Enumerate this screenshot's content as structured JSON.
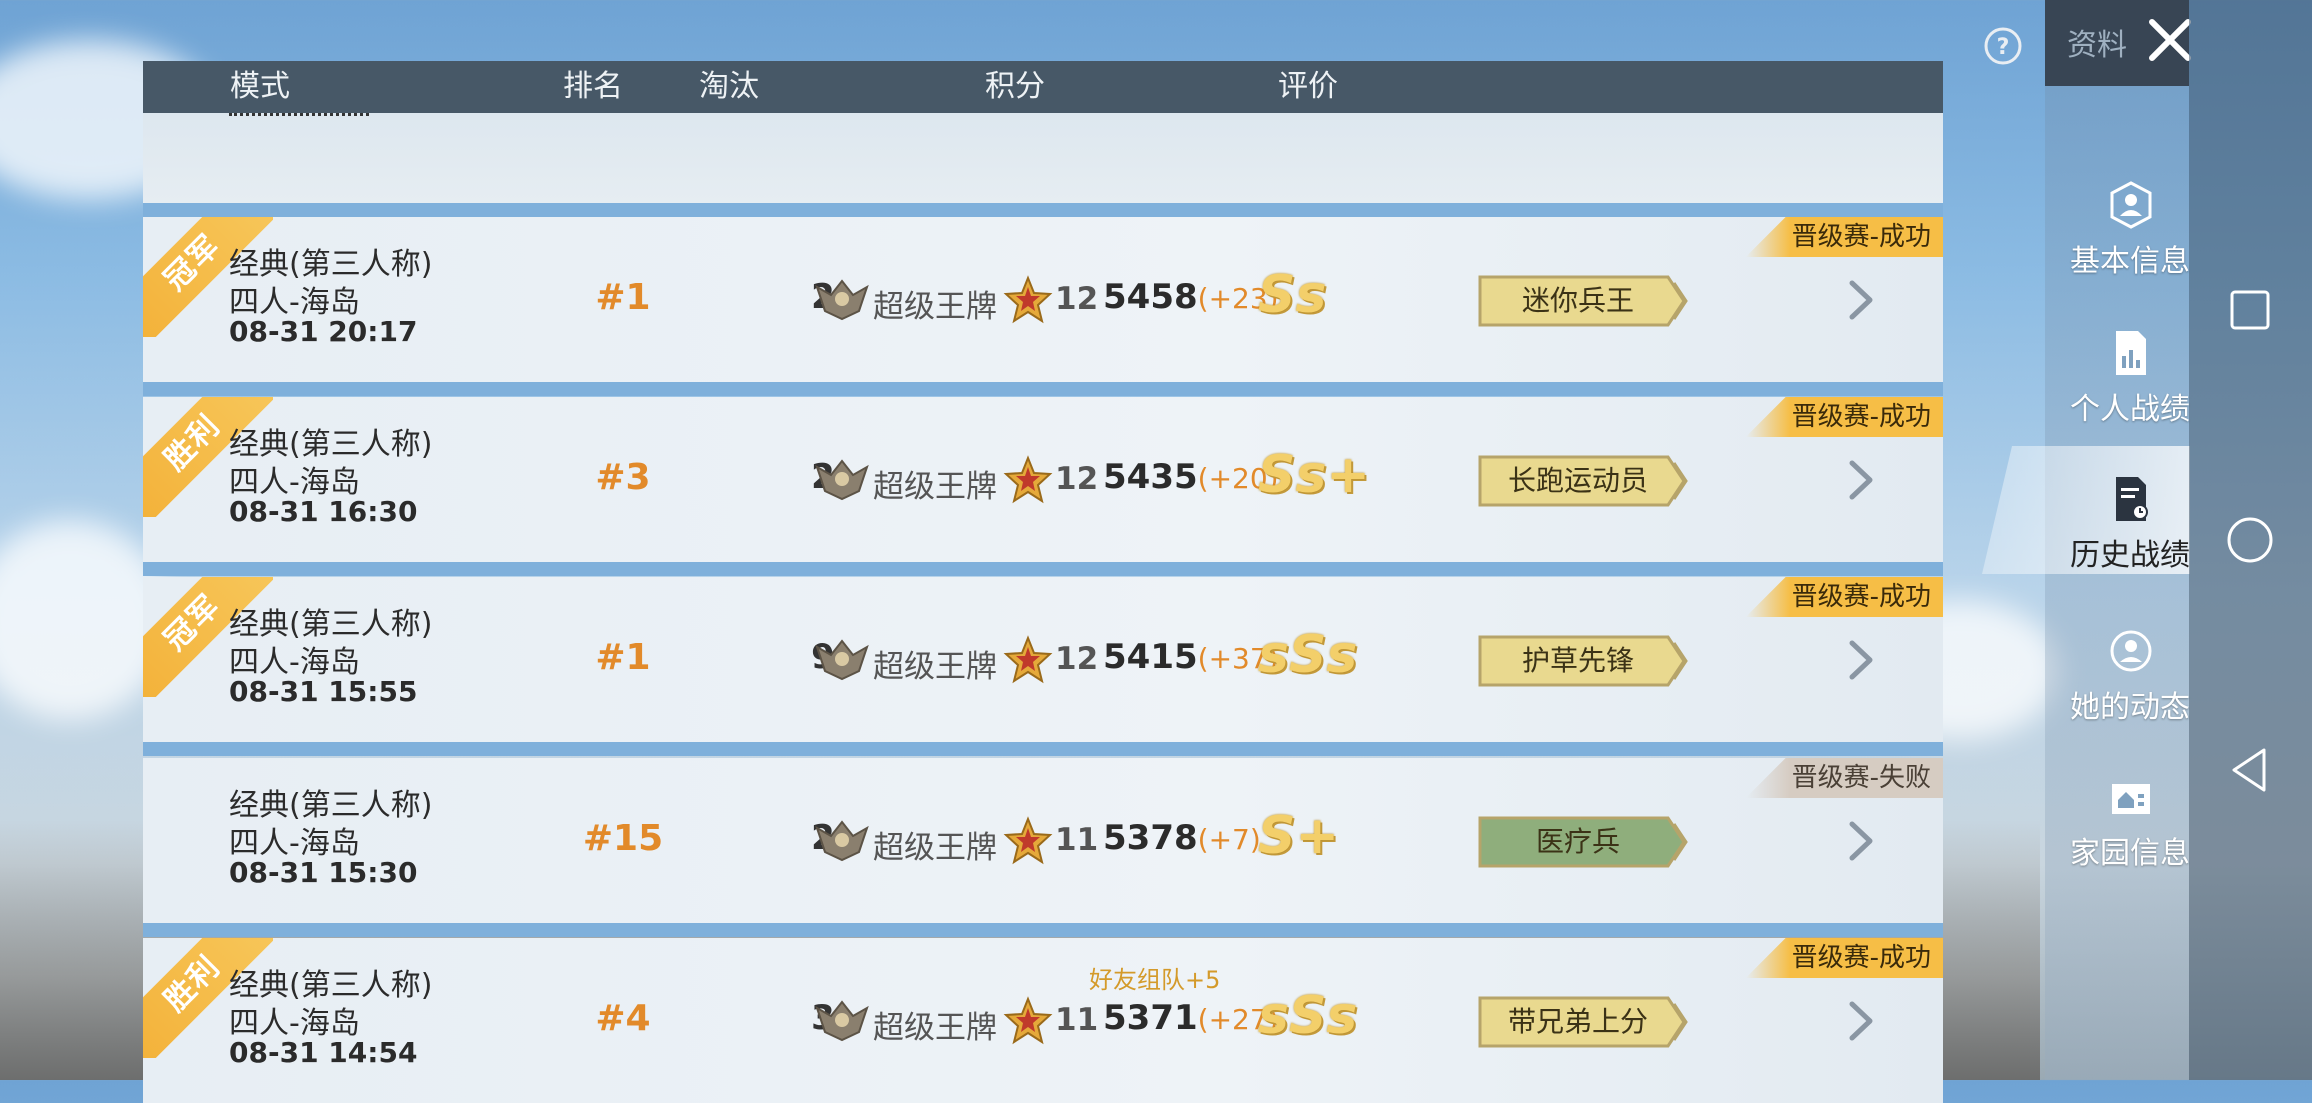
{
  "header": {
    "mode_label": "模式",
    "rank_label": "排名",
    "elim_label": "淘汰",
    "score_label": "积分",
    "rating_label": "评价"
  },
  "side_panel": {
    "title": "资料",
    "nav": [
      {
        "label": "基本信息",
        "icon": "profile-icon"
      },
      {
        "label": "个人战绩",
        "icon": "stats-icon"
      },
      {
        "label": "历史战绩",
        "icon": "history-icon",
        "active": true
      },
      {
        "label": "她的动态",
        "icon": "activity-icon"
      },
      {
        "label": "家园信息",
        "icon": "home-icon"
      }
    ]
  },
  "matches": [
    {
      "ribbon": "冠军",
      "mode": "经典(第三人称)",
      "map": "四人-海岛",
      "time": "08-31 20:17",
      "rank": "#1",
      "eliminations": "2",
      "tier": "超级王牌",
      "stars": "12",
      "score": "5458",
      "delta": "(+23)",
      "grade": "Ss",
      "tag": "迷你兵王",
      "badge": "晋级赛-成功",
      "badge_status": "success",
      "team_bonus": ""
    },
    {
      "ribbon": "胜利",
      "mode": "经典(第三人称)",
      "map": "四人-海岛",
      "time": "08-31 16:30",
      "rank": "#3",
      "eliminations": "2",
      "tier": "超级王牌",
      "stars": "12",
      "score": "5435",
      "delta": "(+20)",
      "grade": "Ss+",
      "tag": "长跑运动员",
      "badge": "晋级赛-成功",
      "badge_status": "success",
      "team_bonus": ""
    },
    {
      "ribbon": "冠军",
      "mode": "经典(第三人称)",
      "map": "四人-海岛",
      "time": "08-31 15:55",
      "rank": "#1",
      "eliminations": "9",
      "tier": "超级王牌",
      "stars": "12",
      "score": "5415",
      "delta": "(+37)",
      "grade": "sSs",
      "tag": "护草先锋",
      "badge": "晋级赛-成功",
      "badge_status": "success",
      "team_bonus": ""
    },
    {
      "ribbon": "",
      "mode": "经典(第三人称)",
      "map": "四人-海岛",
      "time": "08-31 15:30",
      "rank": "#15",
      "eliminations": "2",
      "tier": "超级王牌",
      "stars": "11",
      "score": "5378",
      "delta": "(+7)",
      "grade": "S+",
      "tag": "医疗兵",
      "badge": "晋级赛-失败",
      "badge_status": "fail",
      "team_bonus": ""
    },
    {
      "ribbon": "胜利",
      "mode": "经典(第三人称)",
      "map": "四人-海岛",
      "time": "08-31 14:54",
      "rank": "#4",
      "eliminations": "3",
      "tier": "超级王牌",
      "stars": "11",
      "score": "5371",
      "delta": "(+27)",
      "grade": "sSs",
      "tag": "带兄弟上分",
      "badge": "晋级赛-成功",
      "badge_status": "success",
      "team_bonus": "好友组队+5"
    }
  ],
  "colors": {
    "header_bg": "#475867",
    "accent_orange": "#e28a2a",
    "badge_success": "#f6be46",
    "badge_fail": "#d6ccc2",
    "tag_gold": "#e9d98f",
    "tag_green": "#8fae7c"
  }
}
